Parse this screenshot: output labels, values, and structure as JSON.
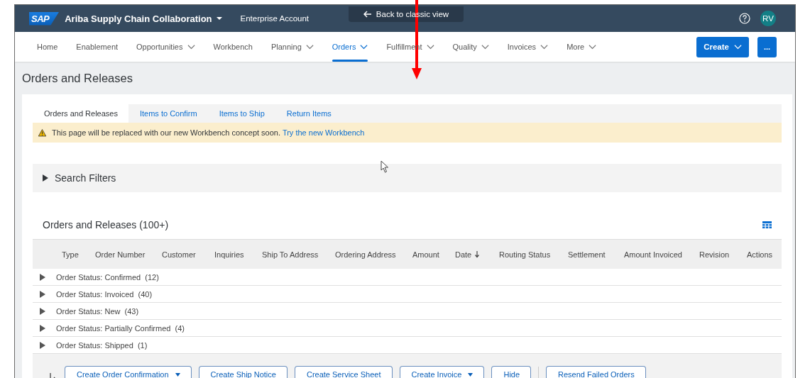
{
  "header": {
    "logo": "SAP",
    "product": "Ariba Supply Chain Collaboration",
    "account": "Enterprise Account",
    "back_button": "Back to classic view",
    "avatar": "RV"
  },
  "nav": [
    {
      "label": "Home",
      "dropdown": false,
      "selected": false
    },
    {
      "label": "Enablement",
      "dropdown": false,
      "selected": false
    },
    {
      "label": "Opportunities",
      "dropdown": true,
      "selected": false
    },
    {
      "label": "Workbench",
      "dropdown": false,
      "selected": false
    },
    {
      "label": "Planning",
      "dropdown": true,
      "selected": false
    },
    {
      "label": "Orders",
      "dropdown": true,
      "selected": true
    },
    {
      "label": "Fulfillment",
      "dropdown": true,
      "selected": false
    },
    {
      "label": "Quality",
      "dropdown": true,
      "selected": false
    },
    {
      "label": "Invoices",
      "dropdown": true,
      "selected": false
    },
    {
      "label": "More",
      "dropdown": true,
      "selected": false
    }
  ],
  "create_button": "Create",
  "more_button": "...",
  "page_title": "Orders and Releases",
  "tabs": [
    {
      "label": "Orders and Releases",
      "selected": true
    },
    {
      "label": "Items to Confirm",
      "selected": false
    },
    {
      "label": "Items to Ship",
      "selected": false
    },
    {
      "label": "Return Items",
      "selected": false
    }
  ],
  "notice": {
    "text": "This page will be replaced with our new Workbench concept soon.",
    "link": "Try the new Workbench"
  },
  "search_filters": {
    "label": "Search Filters",
    "expanded": false
  },
  "table": {
    "title": "Orders and Releases (100+)",
    "columns": [
      {
        "label": "Type",
        "sorted": false
      },
      {
        "label": "Order Number",
        "sorted": false
      },
      {
        "label": "Customer",
        "sorted": false
      },
      {
        "label": "Inquiries",
        "sorted": false
      },
      {
        "label": "Ship To Address",
        "sorted": false
      },
      {
        "label": "Ordering Address",
        "sorted": false
      },
      {
        "label": "Amount",
        "sorted": false
      },
      {
        "label": "Date",
        "sorted": true
      },
      {
        "label": "Routing Status",
        "sorted": false
      },
      {
        "label": "Settlement",
        "sorted": false
      },
      {
        "label": "Amount Invoiced",
        "sorted": false
      },
      {
        "label": "Revision",
        "sorted": false
      },
      {
        "label": "Actions",
        "sorted": false
      }
    ],
    "groups": [
      {
        "label": "Order Status: Confirmed  (12)",
        "expanded": false
      },
      {
        "label": "Order Status: Invoiced  (40)",
        "expanded": false
      },
      {
        "label": "Order Status: New  (43)",
        "expanded": false
      },
      {
        "label": "Order Status: Partially Confirmed  (4)",
        "expanded": false
      },
      {
        "label": "Order Status: Shipped  (1)",
        "expanded": false
      }
    ]
  },
  "actions": [
    {
      "label": "Create Order Confirmation",
      "dropdown": true,
      "separated": false
    },
    {
      "label": "Create Ship Notice",
      "dropdown": false,
      "separated": false
    },
    {
      "label": "Create Service Sheet",
      "dropdown": false,
      "separated": false
    },
    {
      "label": "Create Invoice",
      "dropdown": true,
      "separated": false
    },
    {
      "label": "Hide",
      "dropdown": false,
      "separated": false
    },
    {
      "label": "Resend Failed Orders",
      "dropdown": false,
      "separated": true
    }
  ]
}
